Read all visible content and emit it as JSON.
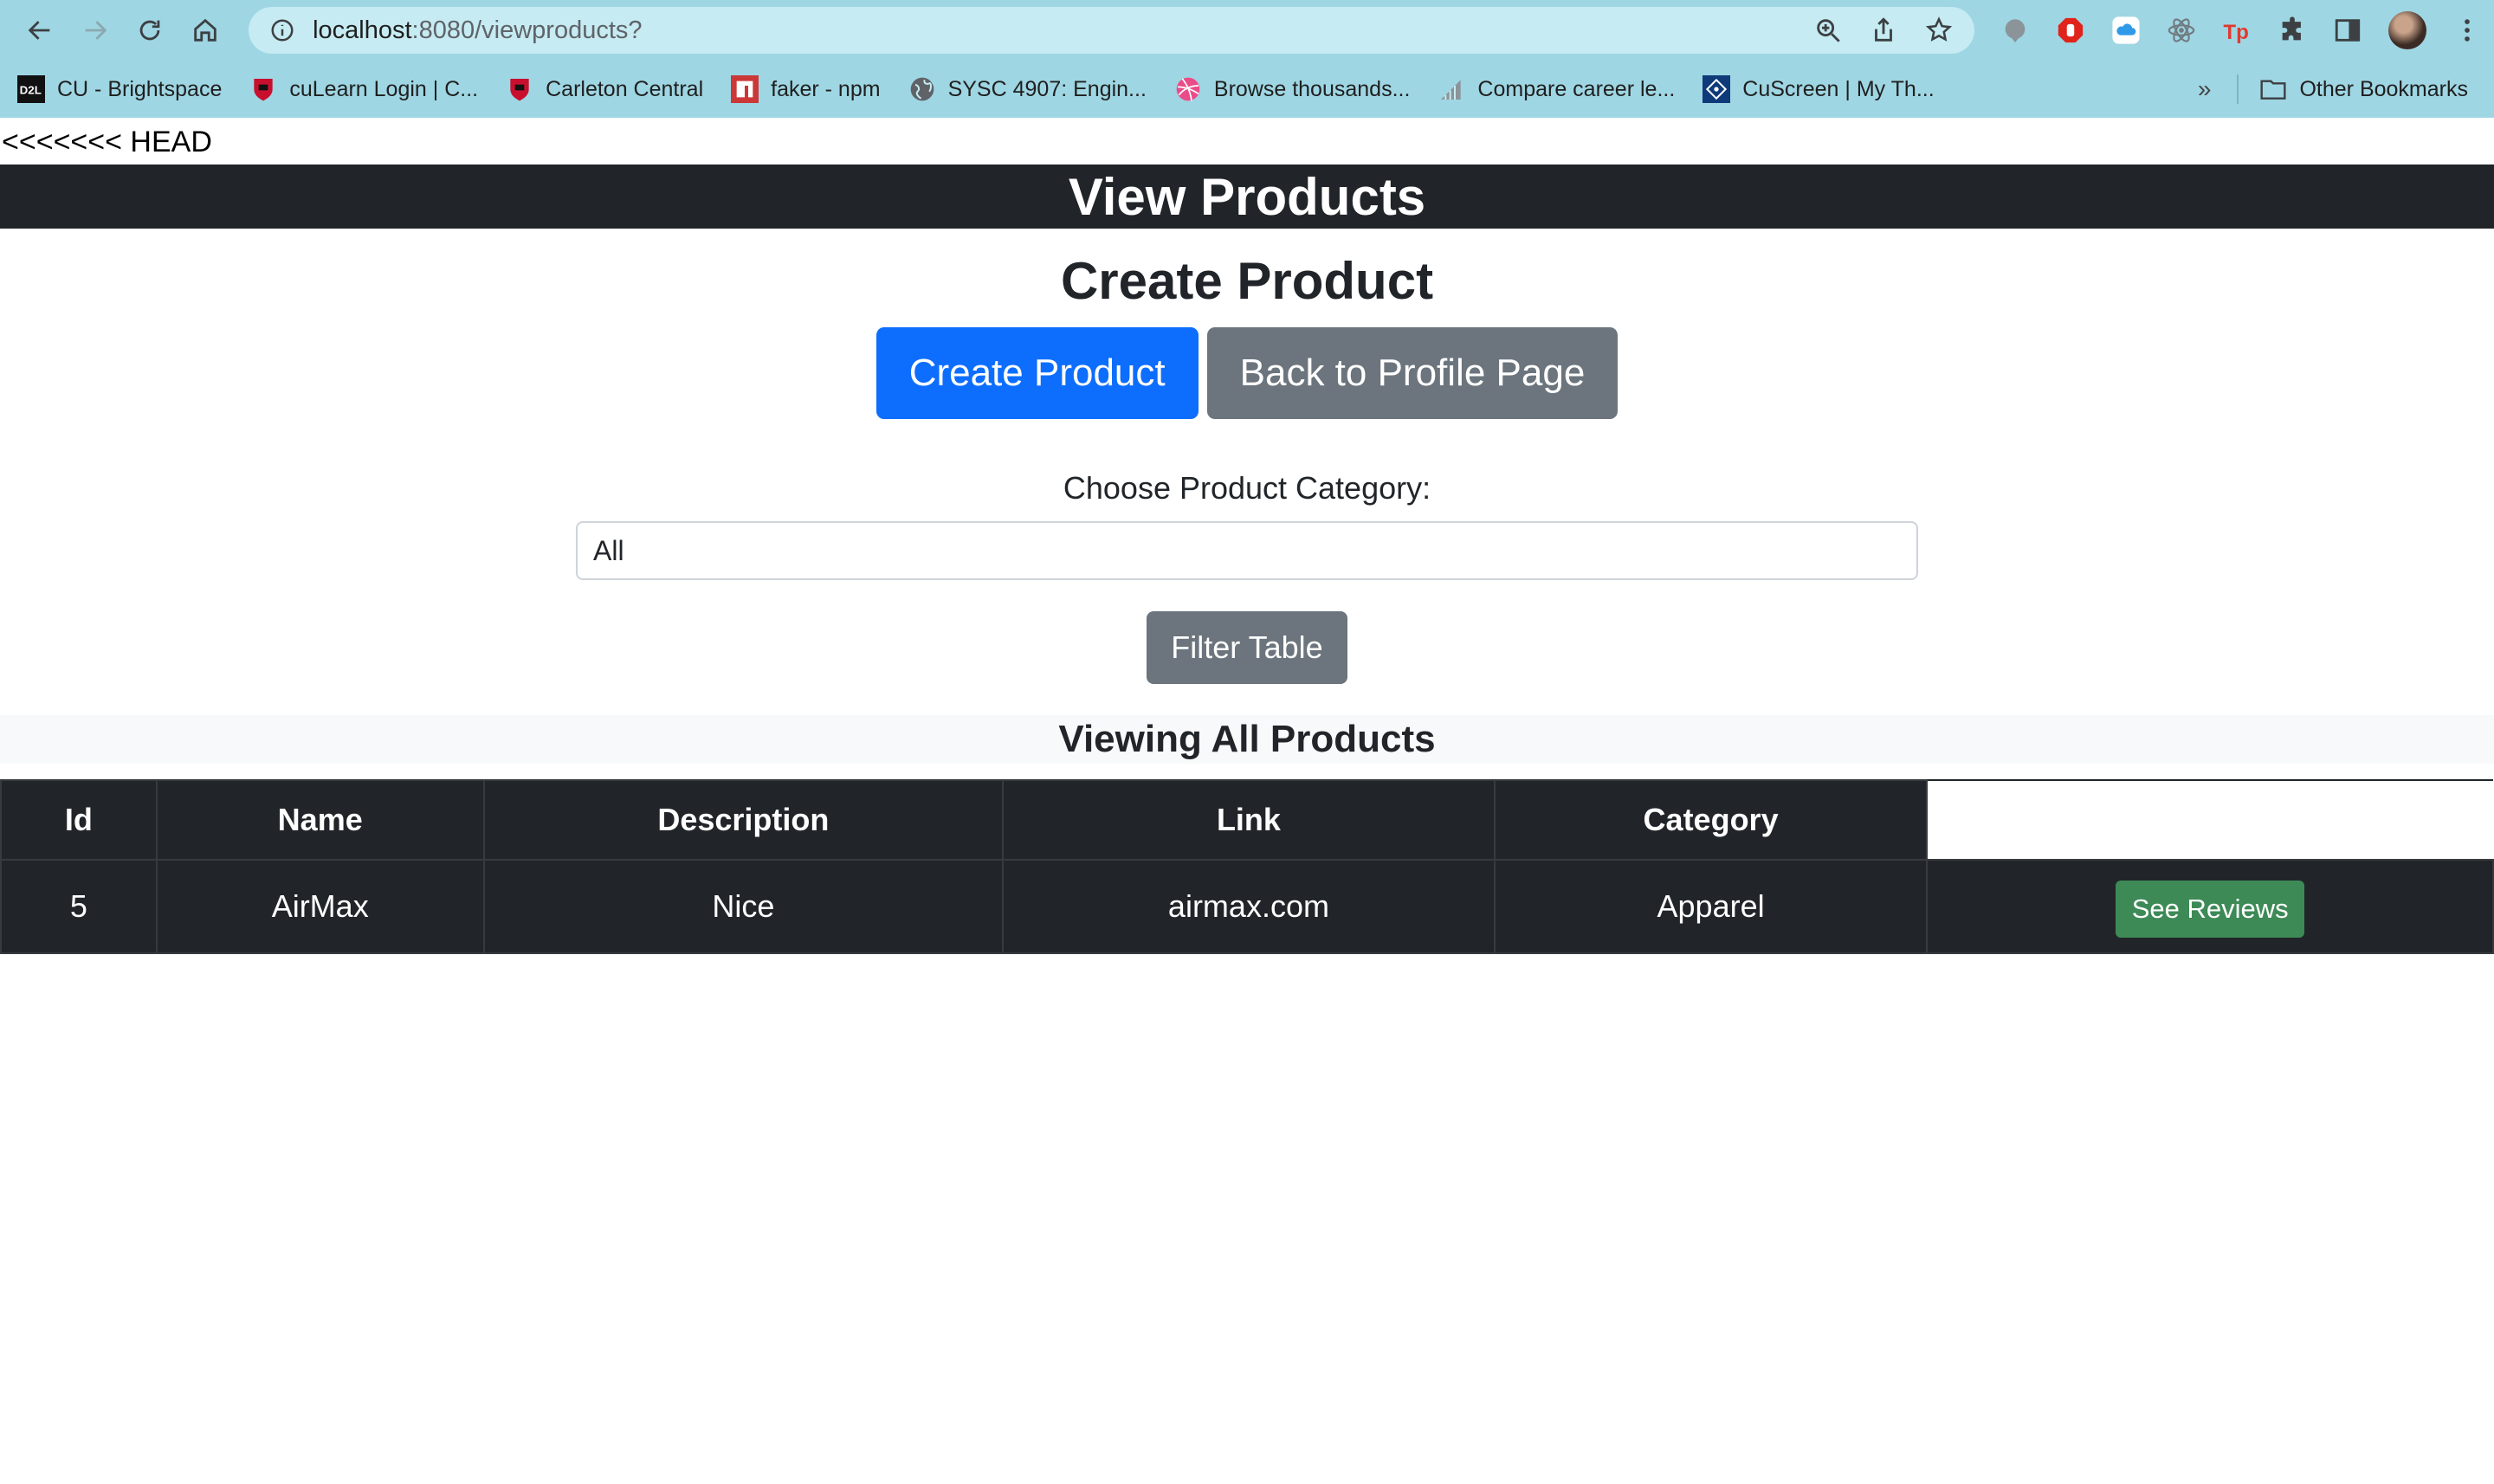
{
  "browser": {
    "url_host": "localhost",
    "url_path": ":8080/viewproducts?",
    "bookmarks": [
      {
        "label": "CU - Brightspace",
        "icon": "d2l-icon"
      },
      {
        "label": "cuLearn Login | C...",
        "icon": "carleton-icon"
      },
      {
        "label": "Carleton Central",
        "icon": "carleton-icon"
      },
      {
        "label": "faker - npm",
        "icon": "npm-icon"
      },
      {
        "label": "SYSC 4907: Engin...",
        "icon": "globe-icon"
      },
      {
        "label": "Browse thousands...",
        "icon": "dribbble-icon"
      },
      {
        "label": "Compare career le...",
        "icon": "chart-icon"
      },
      {
        "label": "CuScreen | My Th...",
        "icon": "cuscreen-icon"
      }
    ],
    "more_bookmarks": "»",
    "other_bookmarks": "Other Bookmarks"
  },
  "page": {
    "git_marker": "<<<<<<< HEAD",
    "banner_title": "View Products",
    "section_title": "Create Product",
    "create_button": "Create Product",
    "back_button": "Back to Profile Page",
    "category_label": "Choose Product Category:",
    "category_selected": "All",
    "filter_button": "Filter Table",
    "viewing_title": "Viewing All Products"
  },
  "table": {
    "headers": [
      "Id",
      "Name",
      "Description",
      "Link",
      "Category"
    ],
    "rows": [
      {
        "id": "5",
        "name": "AirMax",
        "description": "Nice",
        "link": "airmax.com",
        "category": "Apparel",
        "action": "See Reviews"
      }
    ]
  },
  "colors": {
    "chrome": "#9fd6e3",
    "primary": "#0d6efd",
    "secondary": "#6c757d",
    "success": "#3d8a57",
    "dark": "#212529"
  }
}
